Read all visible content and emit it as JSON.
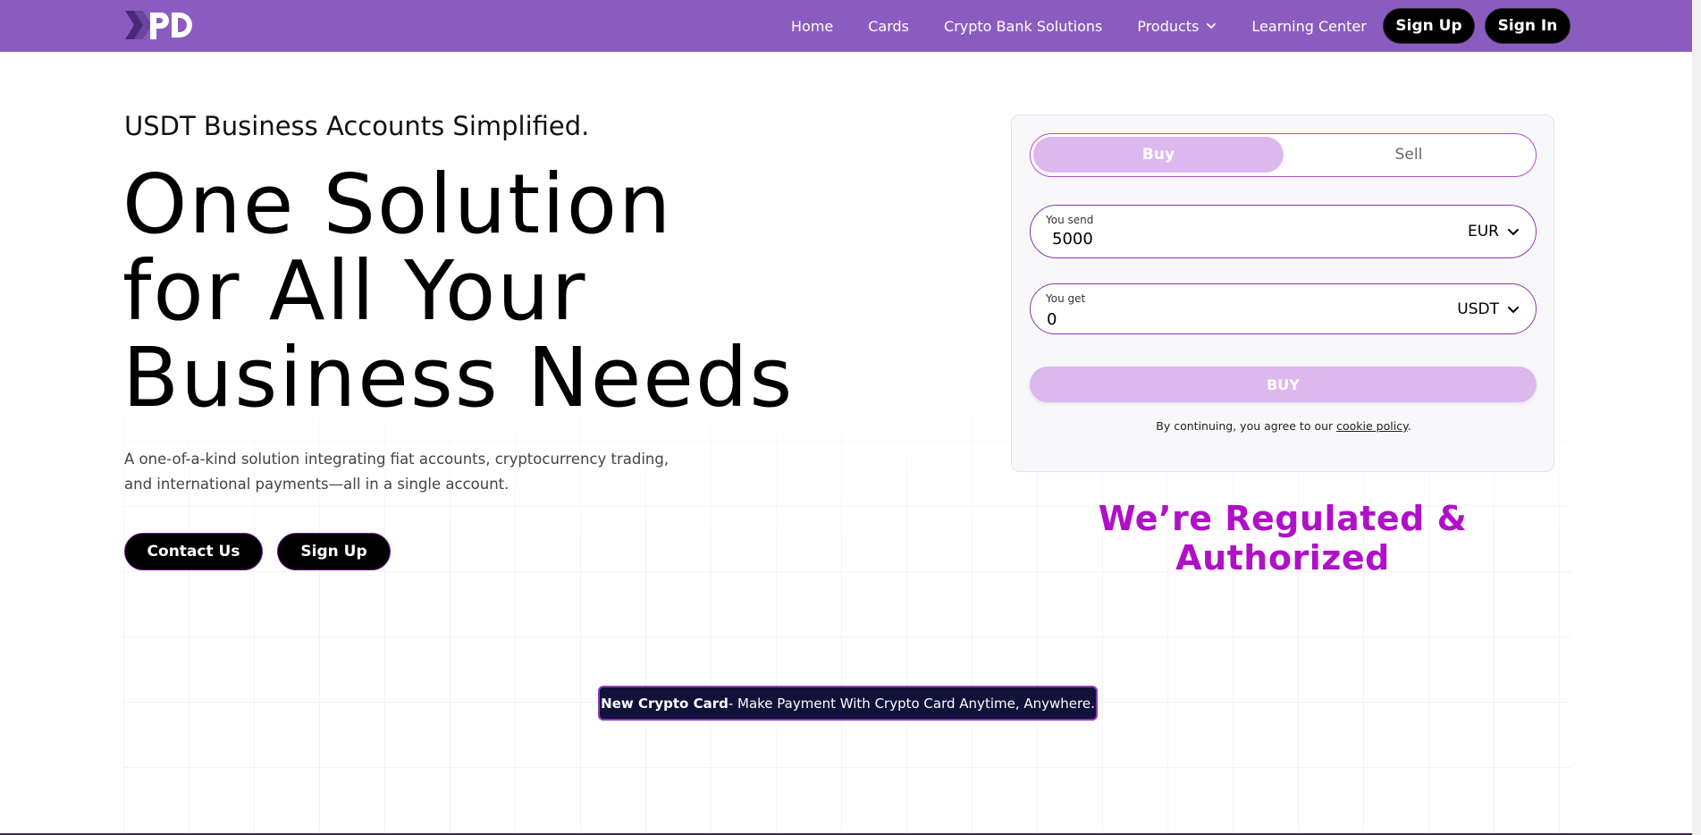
{
  "header": {
    "logo_text": "XPD",
    "nav": [
      {
        "label": "Home"
      },
      {
        "label": "Cards"
      },
      {
        "label": "Crypto Bank Solutions"
      },
      {
        "label": "Products",
        "has_dropdown": true
      },
      {
        "label": "Learning Center"
      }
    ],
    "signup_label": "Sign Up",
    "signin_label": "Sign In",
    "background": "#8b5cc0"
  },
  "hero": {
    "eyebrow": "USDT Business Accounts Simplified.",
    "headline_lines": [
      "One Solution",
      "for All Your",
      "Business Needs"
    ],
    "description": "A one-of-a-kind solution integrating fiat accounts, cryptocurrency trading, and international payments—all in a single account.",
    "contact_label": "Contact Us",
    "signup_label": "Sign Up"
  },
  "widget": {
    "tabs": [
      {
        "label": "Buy",
        "active": true
      },
      {
        "label": "Sell",
        "active": false
      }
    ],
    "send": {
      "label": "You send",
      "value": "5000",
      "currency": "EUR"
    },
    "get": {
      "label": "You get",
      "value": "0",
      "currency": "USDT"
    },
    "buy_button": "BUY",
    "consent_prefix": "By continuing, you agree to our ",
    "consent_link": "cookie policy",
    "consent_suffix": ".",
    "accent": "#dcb8ee"
  },
  "regulated_text": "We’re Regulated & Authorized",
  "promo": {
    "bold": "New Crypto Card",
    "rest": " - Make Payment With Crypto Card Anytime, Anywhere."
  }
}
